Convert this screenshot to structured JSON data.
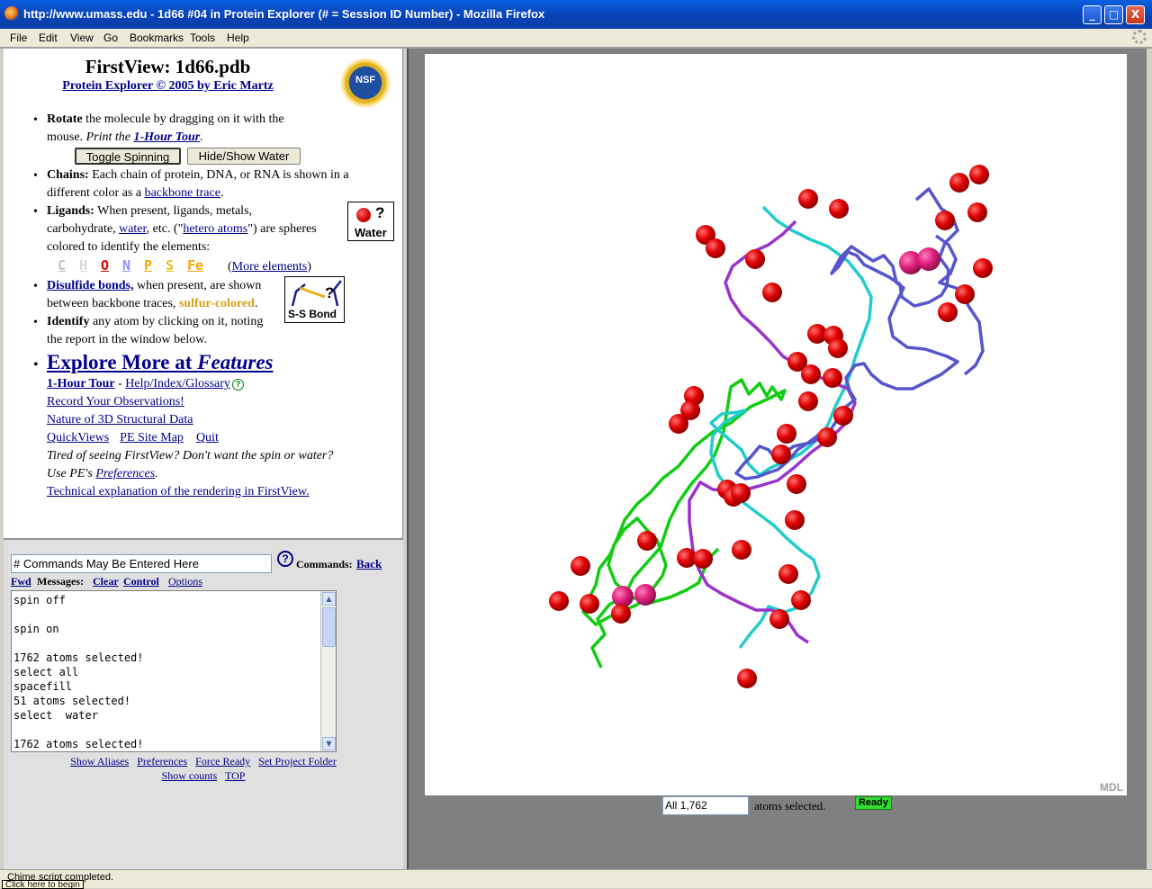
{
  "window": {
    "title": "http://www.umass.edu - 1d66 #04 in Protein Explorer (# = Session ID Number) - Mozilla Firefox",
    "buttons": [
      "_",
      "□",
      "X"
    ]
  },
  "menubar": [
    "File",
    "Edit",
    "View",
    "Go",
    "Bookmarks",
    "Tools",
    "Help"
  ],
  "left": {
    "title": "FirstView: 1d66.pdb",
    "subtitle": "Protein Explorer © 2005 by Eric Martz",
    "logo": "NSF",
    "rotate": {
      "bold": "Rotate",
      "text1": " the molecule by dragging on it with the",
      "text2": "mouse. ",
      "print": "Print the ",
      "tour": "1-Hour Tour",
      "dot": "."
    },
    "buttons": {
      "toggle": "Toggle Spinning",
      "water": "Hide/Show Water"
    },
    "chains": {
      "bold": "Chains:",
      "text1": " Each chain of protein, DNA, or RNA is shown in a",
      "text2": "different color as a ",
      "link": "backbone trace",
      "end": "."
    },
    "ligands": {
      "bold": "Ligands:",
      "t1": " When present, ligands, metals,",
      "t2a": "carbohydrate, ",
      "water": "water",
      "t2b": ", etc. (\"",
      "hetero": "hetero atoms",
      "t2c": "\") are spheres",
      "t3": "colored to identify the elements:"
    },
    "water_icon": {
      "q": "?",
      "label": "Water"
    },
    "elements": [
      "C",
      "H",
      "O",
      "N",
      "P",
      "S",
      "Fe"
    ],
    "more_elements": "More elements",
    "disulfide": {
      "link": "Disulfide bonds,",
      "t1": " when present, are shown",
      "t2": "between backbone traces, ",
      "sulfur": "sulfur-colored",
      "end": "."
    },
    "ss_icon": {
      "q": "?",
      "label": "S-S Bond"
    },
    "identify": {
      "bold": "Identify",
      "t1": " any atom by clicking on it, noting",
      "t2": "the report in the window below."
    },
    "explore": {
      "main": "Explore More at ",
      "features": "Features"
    },
    "links": {
      "tour": "1-Hour Tour",
      "sep": " - ",
      "help": "Help/Index/Glossary",
      "record": "Record Your Observations!",
      "nature": "Nature of 3D Structural Data",
      "quickviews": "QuickViews",
      "sitemap": "PE Site Map",
      "quit": "Quit",
      "tired": "Tired of seeing FirstView? Don't want the spin or water?",
      "use": "Use PE's ",
      "prefs": "Preferences",
      "dot": ".",
      "technical": "Technical explanation of the rendering in FirstView."
    }
  },
  "commands": {
    "input_value": "# Commands May Be Entered Here",
    "label": "Commands:",
    "back": "Back",
    "fwd": "Fwd",
    "messages": "Messages:",
    "clear": "Clear",
    "control": "Control",
    "options": "Options",
    "log": "spin off\n\nspin on\n\n1762 atoms selected!\nselect all\nspacefill\n51 atoms selected!\nselect  water\n\n1762 atoms selected!",
    "bottom_links": [
      "Show Aliases",
      "Preferences",
      "Force Ready",
      "Set Project Folder"
    ],
    "bottom_links2": [
      "Show counts",
      "TOP"
    ]
  },
  "viewer": {
    "watermark": "MDL",
    "selected_value": "All 1,762",
    "selected_text": "atoms selected.",
    "status": "Ready"
  },
  "statusbar": {
    "left": "Chime script completed.",
    "tooltip": "Click here to begin"
  },
  "colors": {
    "accent": "#0842b8",
    "water_sphere": "#ee0000",
    "chain_green": "#11cc11",
    "chain_cyan": "#22cccc",
    "chain_purple": "#9933cc",
    "chain_blue": "#5555cc",
    "sulfur": "#d4a017",
    "ready": "#33dd33"
  }
}
